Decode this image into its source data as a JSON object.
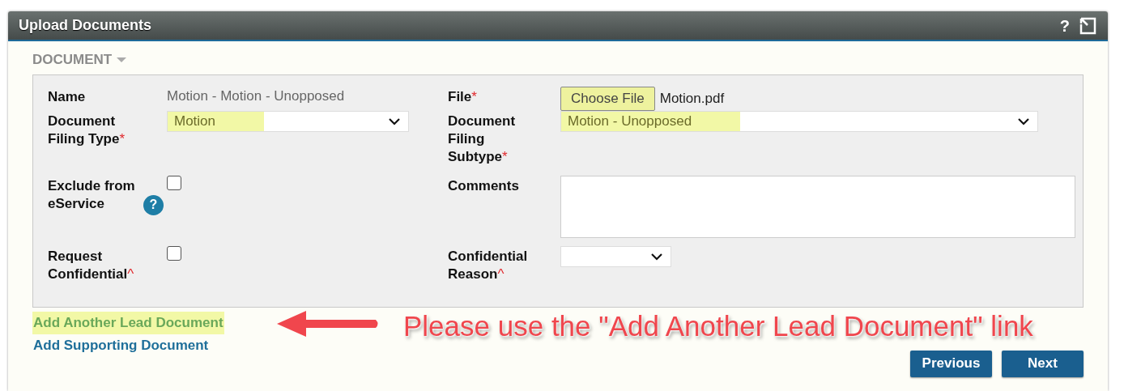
{
  "window": {
    "title": "Upload Documents",
    "help_button": "?"
  },
  "section": {
    "title": "DOCUMENT",
    "expanded": true
  },
  "fields": [
    {
      "kind": "text",
      "label": "Name",
      "value": "Motion - Motion - Unopposed"
    },
    {
      "kind": "file",
      "label": "File",
      "required_mark": "*",
      "button": "Choose File",
      "value": "Motion.pdf",
      "highlighted": true
    },
    {
      "kind": "select",
      "label": "Document Filing Type",
      "required_mark": "*",
      "value": "Motion",
      "highlighted": true
    },
    {
      "kind": "select",
      "label": "Document Filing Subtype",
      "required_mark": "*",
      "value": "Motion - Unopposed",
      "highlighted": true
    },
    {
      "kind": "checkbox",
      "label": "Exclude from eService",
      "help": "?",
      "checked": false
    },
    {
      "kind": "textarea",
      "label": "Comments"
    },
    {
      "kind": "checkbox",
      "label": "Request Confidential",
      "required_mark": "^",
      "checked": false
    },
    {
      "kind": "select",
      "label": "Confidential Reason",
      "required_mark": "^"
    }
  ],
  "links": [
    {
      "label": "Add Another Lead Document",
      "highlighted": true
    },
    {
      "label": "Add Supporting Document",
      "highlighted": false
    }
  ],
  "annotation": {
    "text": "Please use the \"Add Another Lead Document\" link"
  },
  "buttons": [
    "Previous",
    "Next"
  ]
}
